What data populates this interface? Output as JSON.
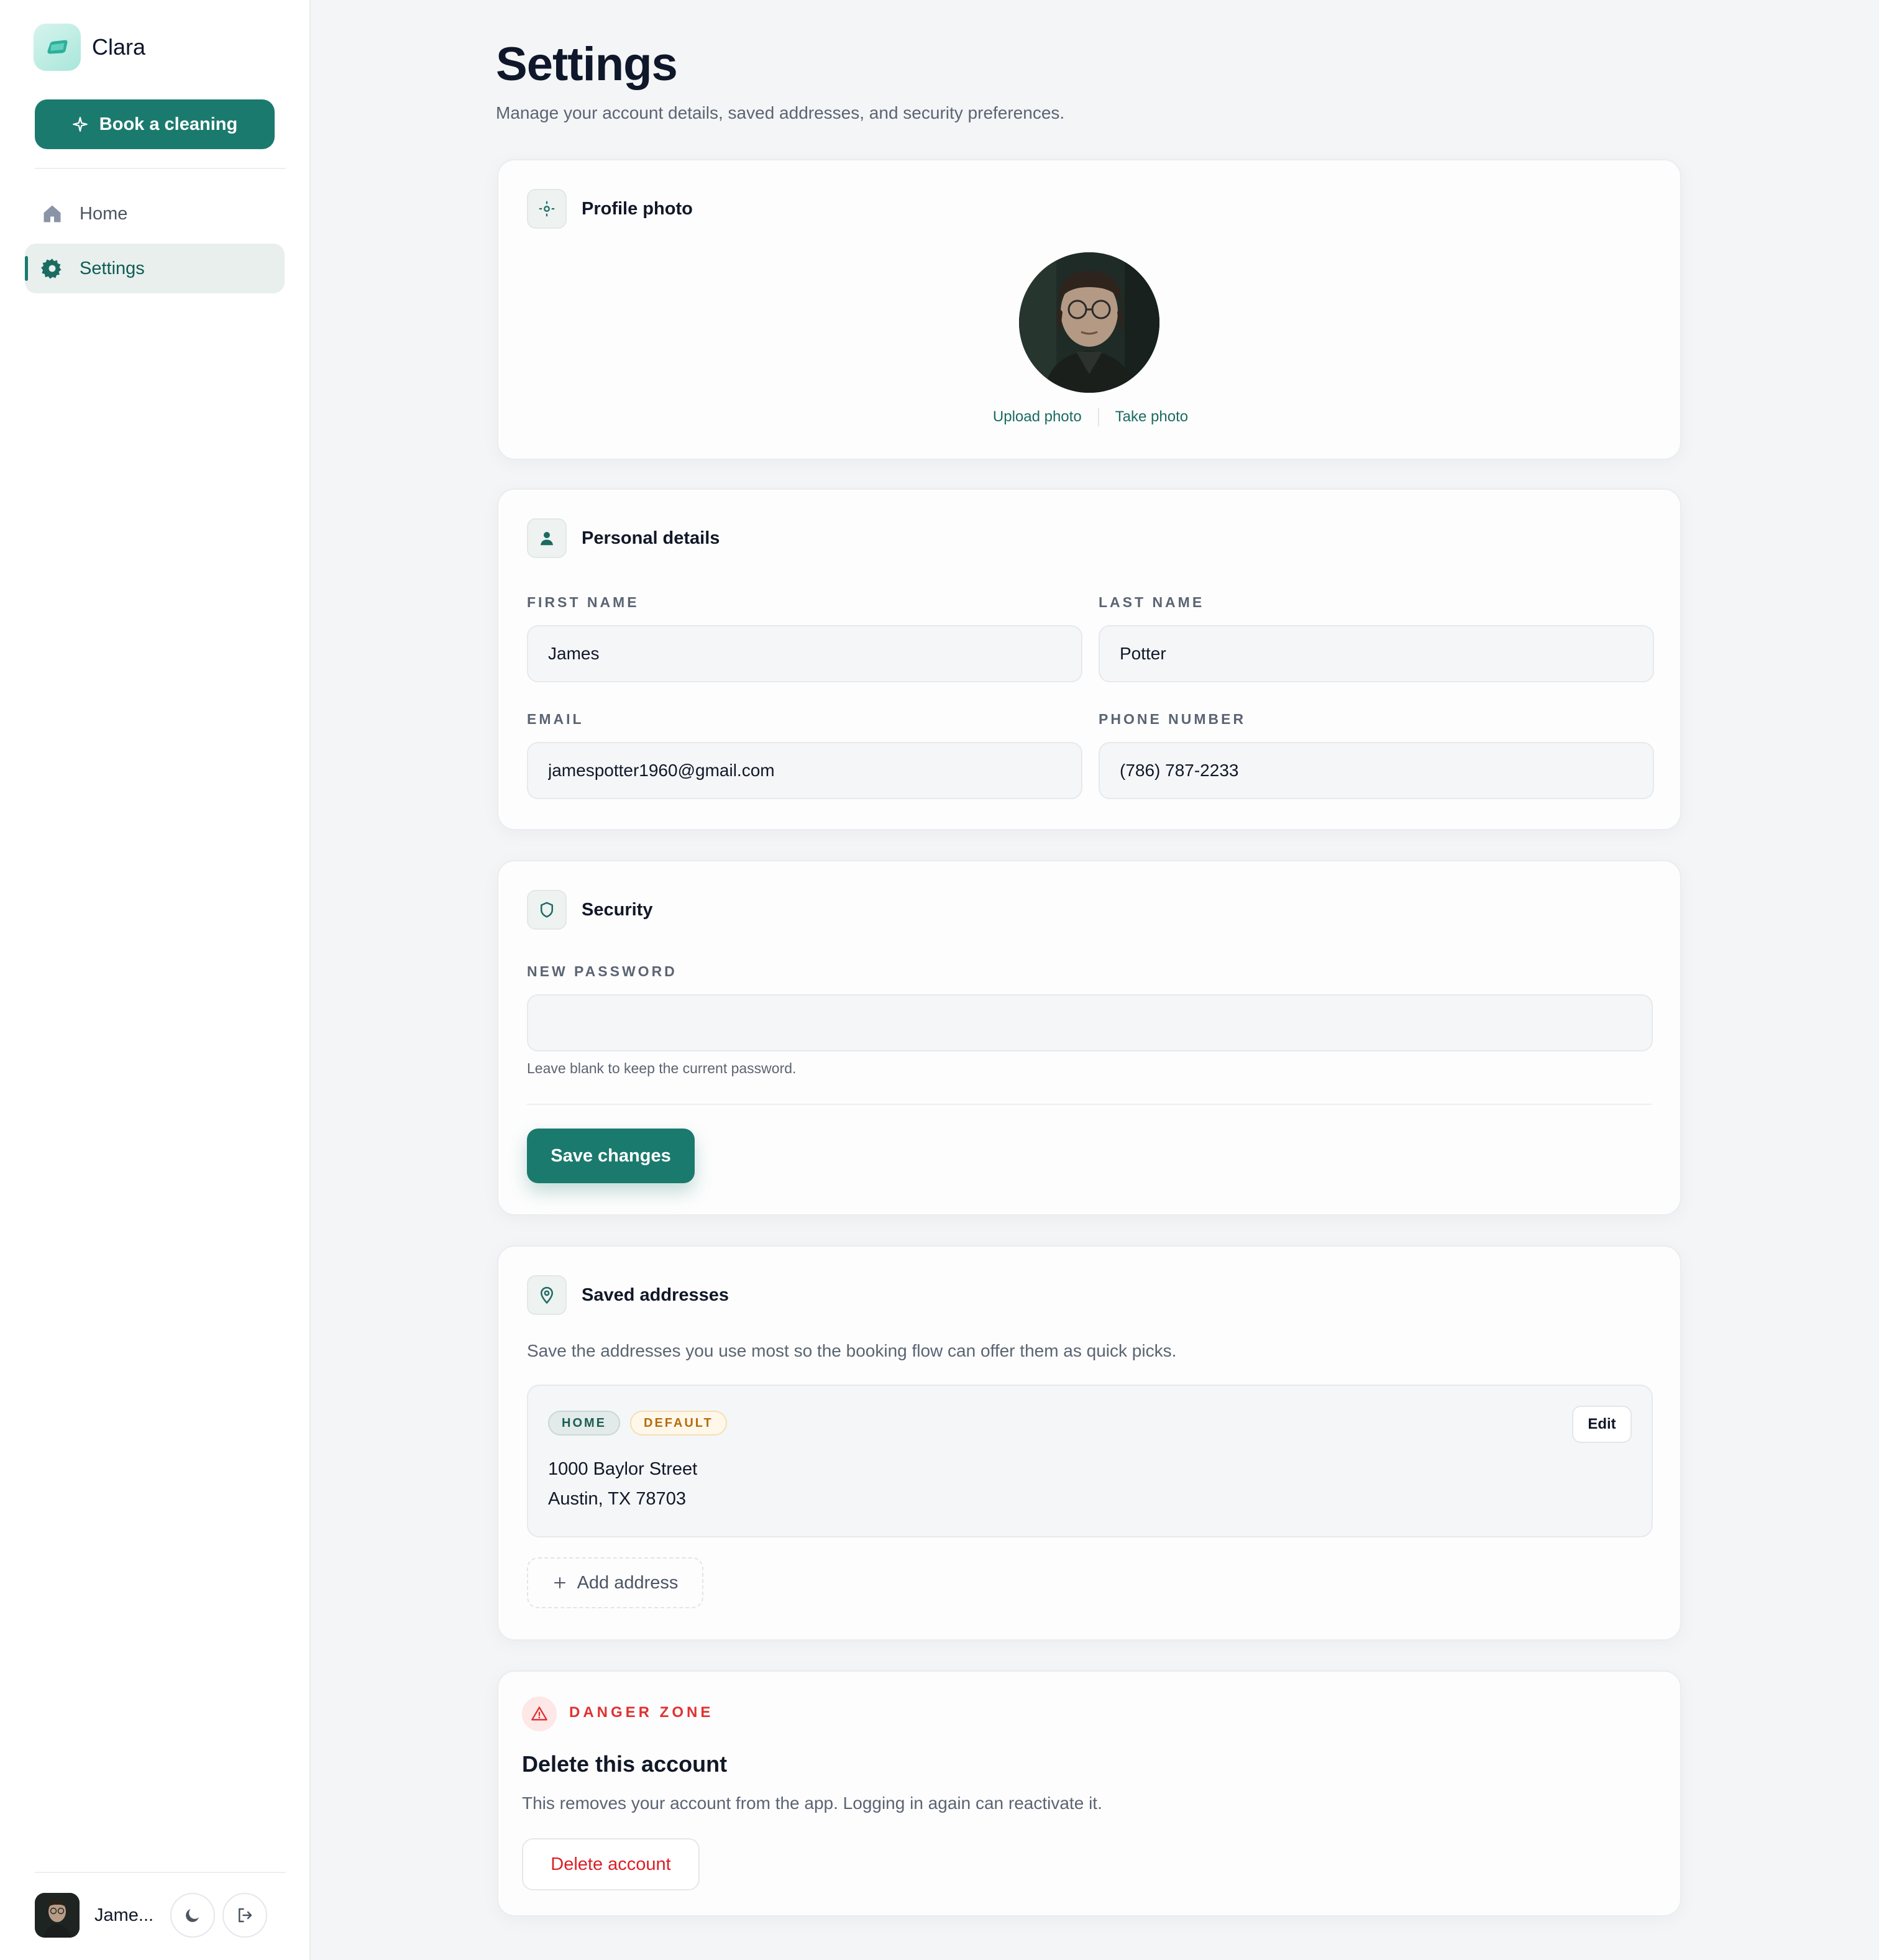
{
  "app": {
    "name": "Clara"
  },
  "sidebar": {
    "book_label": "Book a cleaning",
    "nav": [
      {
        "label": "Home",
        "icon": "home-icon"
      },
      {
        "label": "Settings",
        "icon": "gear-icon"
      }
    ],
    "user": {
      "name": "Jame..."
    }
  },
  "page": {
    "title": "Settings",
    "subtitle": "Manage your account details, saved addresses, and security preferences."
  },
  "profile_photo": {
    "title": "Profile photo",
    "upload_label": "Upload photo",
    "take_label": "Take photo"
  },
  "personal": {
    "title": "Personal details",
    "first_name": {
      "label": "FIRST NAME",
      "value": "James"
    },
    "last_name": {
      "label": "LAST NAME",
      "value": "Potter"
    },
    "email": {
      "label": "EMAIL",
      "value": "jamespotter1960@gmail.com"
    },
    "phone": {
      "label": "PHONE NUMBER",
      "value": "(786) 787-2233"
    }
  },
  "security": {
    "title": "Security",
    "password_label": "NEW PASSWORD",
    "password_value": "",
    "hint": "Leave blank to keep the current password.",
    "save_label": "Save changes"
  },
  "addresses": {
    "title": "Saved addresses",
    "description": "Save the addresses you use most so the booking flow can offer them as quick picks.",
    "items": [
      {
        "tags": [
          "HOME",
          "DEFAULT"
        ],
        "line1": "1000 Baylor Street",
        "line2": "Austin, TX 78703",
        "edit_label": "Edit"
      }
    ],
    "add_label": "Add address"
  },
  "danger": {
    "label": "DANGER ZONE",
    "title": "Delete this account",
    "description": "This removes your account from the app. Logging in again can reactivate it.",
    "delete_label": "Delete account"
  },
  "colors": {
    "accent": "#1b7a6e",
    "danger": "#e03131",
    "default_tag": "#b86b0b"
  }
}
